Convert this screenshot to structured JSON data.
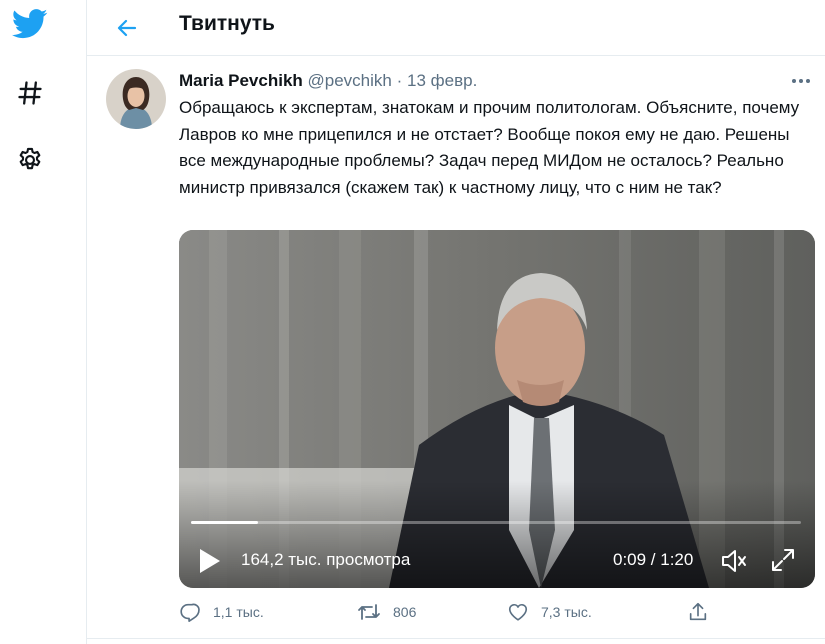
{
  "header": {
    "title": "Твитнуть"
  },
  "tweet": {
    "author_name": "Maria Pevchikh",
    "author_handle": "@pevchikh",
    "separator": "·",
    "date": "13 февр.",
    "text": "Обращаюсь к экспертам, знатокам и прочим политологам. Объясните, почему Лавров ко мне прицепился и не отстает? Вообще покоя ему не даю. Решены все международные проблемы? Задач перед МИДом не осталось? Реально министр привязался (скажем так) к частному лицу, что с ним не так?",
    "video": {
      "views": "164,2 тыс. просмотра",
      "time": "0:09 / 1:20",
      "progress": 0.11
    },
    "actions": {
      "replies": "1,1 тыс.",
      "retweets": "806",
      "likes": "7,3 тыс."
    }
  },
  "colors": {
    "brand": "#1da1f2",
    "muted": "#5b7083"
  }
}
